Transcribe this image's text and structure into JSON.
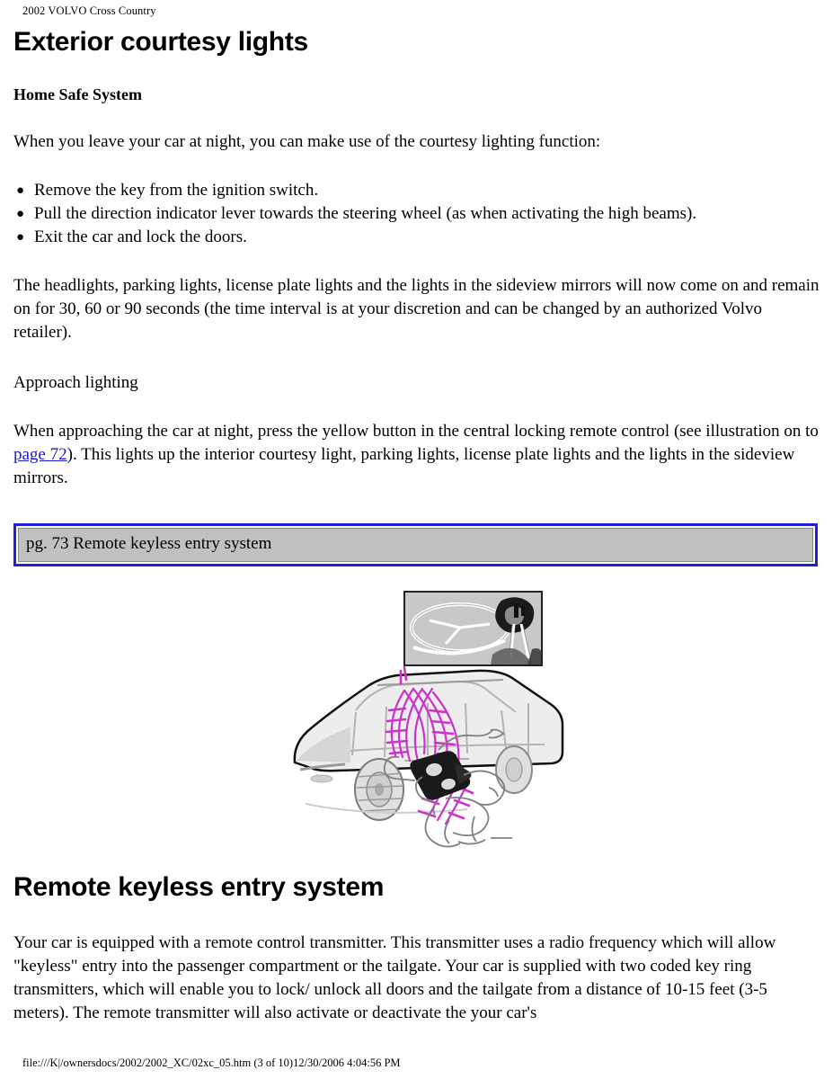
{
  "header": {
    "running_title": "2002 VOLVO Cross Country"
  },
  "main": {
    "title": "Exterior courtesy lights",
    "subhead": "Home Safe System",
    "intro": "When you leave your car at night, you can make use of the courtesy lighting function:",
    "bullets": [
      "Remove the key from the ignition switch.",
      "Pull the direction indicator lever towards the steering wheel (as when activating the high beams).",
      "Exit the car and lock the doors."
    ],
    "paragraph_timing": "The headlights, parking lights, license plate lights and the lights in the sideview mirrors will now come on and remain on for 30, 60 or 90 seconds (the time interval is at your discretion and can be changed by an authorized Volvo retailer).",
    "approach_heading": "Approach lighting",
    "approach_paragraph_part1": "When approaching the car at night, press the yellow button in the central locking remote control (see illustration on to ",
    "approach_link": "page 72",
    "approach_paragraph_part2": "). This lights up the interior courtesy light, parking lights, license plate lights and the lights in the sideview mirrors.",
    "reference_box": "pg. 73 Remote keyless entry system",
    "section2_title": "Remote keyless entry system",
    "section2_paragraph": "Your car is equipped with a remote control transmitter. This transmitter uses a radio frequency which will allow \"keyless\" entry into the passenger compartment or the tailgate. Your car is supplied with two coded key ring transmitters, which will enable you to lock/ unlock all doors and the tailgate from a distance of 10-15 feet (3-5 meters). The remote transmitter will also activate or deactivate the your car's"
  },
  "illustration": {
    "alt": "Car with remote key fob transmitting radio waves, inset of steering wheel and key",
    "wave_color": "#cc33cc",
    "inset_fill": "#c8c8c8",
    "body_fill": "#e8e8e8"
  },
  "footer": {
    "path_line": "file:///K|/ownersdocs/2002/2002_XC/02xc_05.htm (3 of 10)12/30/2006 4:04:56 PM"
  },
  "colors": {
    "link": "#1a1ad0",
    "box_border": "#2020d8",
    "box_fill": "#c0c0c0",
    "text": "#000000"
  }
}
